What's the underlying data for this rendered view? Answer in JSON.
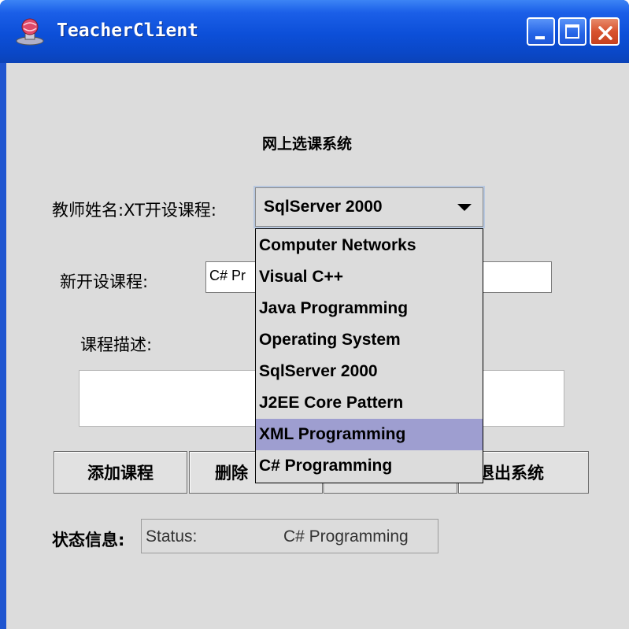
{
  "window": {
    "title": "TeacherClient",
    "icon": "app-globe-icon"
  },
  "titlebar_buttons": [
    "minimize-icon",
    "maximize-icon",
    "close-icon"
  ],
  "header": {
    "system_title": "网上选课系统"
  },
  "teacher": {
    "label": "教师姓名:XT开设课程:"
  },
  "course_combo": {
    "selected": "SqlServer 2000",
    "options": [
      "Computer Networks",
      "Visual C++",
      "Java Programming",
      "Operating System",
      "SqlServer 2000",
      "J2EE Core Pattern",
      "XML Programming",
      "C# Programming"
    ],
    "highlighted": "XML Programming"
  },
  "new_course": {
    "label": "新开设课程:",
    "value": "C# Pr"
  },
  "description": {
    "label": "课程描述:",
    "value": ""
  },
  "buttons": {
    "add": "添加课程",
    "delete": "删除",
    "exit": "退出系统"
  },
  "status": {
    "label": "状态信息:",
    "prefix": "Status:",
    "value": "C# Programming"
  },
  "colors": {
    "titlebar": "#0c4fd8",
    "client_bg": "#dcdcdc",
    "selection": "#9e9ed0"
  }
}
